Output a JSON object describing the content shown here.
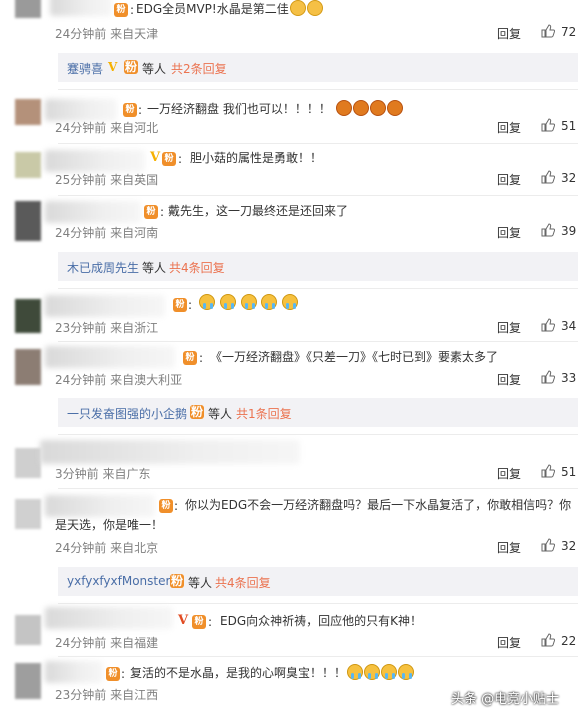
{
  "comments": [
    {
      "id": "c1",
      "text": "EDG全员MVP!水晶是第二佳",
      "emojis": [
        "dog",
        "dog"
      ],
      "time": "24分钟前",
      "location": "来自天津",
      "reply": "回复",
      "likes": "72",
      "sub": {
        "name": "蹇骋喜",
        "suffix": "等人",
        "link": "共2条回复"
      }
    },
    {
      "id": "c2",
      "text": "一万经济翻盘 我们也可以！！！！",
      "emojis": [
        "fire",
        "fire",
        "fire",
        "fire"
      ],
      "time": "24分钟前",
      "location": "来自河北",
      "reply": "回复",
      "likes": "51"
    },
    {
      "id": "c3",
      "text": "胆小菇的属性是勇敢！！",
      "emojis": [],
      "time": "25分钟前",
      "location": "来自英国",
      "reply": "回复",
      "likes": "32"
    },
    {
      "id": "c4",
      "text": "戴先生，这一刀最终还是还回来了",
      "emojis": [],
      "time": "24分钟前",
      "location": "来自河南",
      "reply": "回复",
      "likes": "39",
      "sub": {
        "name": "木已成周先生",
        "suffix": "等人",
        "link": "共4条回复"
      }
    },
    {
      "id": "c5",
      "text": "",
      "emojis": [
        "cry",
        "cry",
        "cry",
        "cry",
        "cry"
      ],
      "time": "23分钟前",
      "location": "来自浙江",
      "reply": "回复",
      "likes": "34"
    },
    {
      "id": "c6",
      "text": "《一万经济翻盘》《只差一刀》《七时已到》要素太多了",
      "emojis": [],
      "time": "24分钟前",
      "location": "来自澳大利亚",
      "reply": "回复",
      "likes": "33",
      "sub": {
        "name": "一只发奋图强的小企鹅",
        "suffix": "等人",
        "link": "共1条回复"
      }
    },
    {
      "id": "c7",
      "text": "",
      "emojis": [],
      "time": "3分钟前",
      "location": "来自广东",
      "reply": "回复",
      "likes": "51"
    },
    {
      "id": "c8",
      "text": "你以为EDG不会一万经济翻盘吗？最后一下水晶复活了，你敢相信吗？你",
      "text2": "是天选，你是唯一！",
      "emojis": [],
      "time": "24分钟前",
      "location": "来自北京",
      "reply": "回复",
      "likes": "32",
      "sub": {
        "name": "yxfyxfyxfMonster",
        "suffix": "等人",
        "link": "共4条回复"
      }
    },
    {
      "id": "c9",
      "text": "EDG向众神祈祷，回应他的只有K神！",
      "emojis": [],
      "time": "24分钟前",
      "location": "来自福建",
      "reply": "回复",
      "likes": "22"
    },
    {
      "id": "c10",
      "text": "复活的不是水晶，是我的心啊臭宝！！！",
      "emojis": [
        "cry",
        "cry",
        "cry",
        "cry"
      ],
      "time": "23分钟前",
      "location": "来自江西",
      "reply": "回复",
      "likes": ""
    }
  ],
  "watermark": "头条 @电竞小贴士",
  "icons": {
    "like": "thumbs-up-icon",
    "badge": "fan-badge-icon",
    "verified": "verified-v-icon"
  }
}
